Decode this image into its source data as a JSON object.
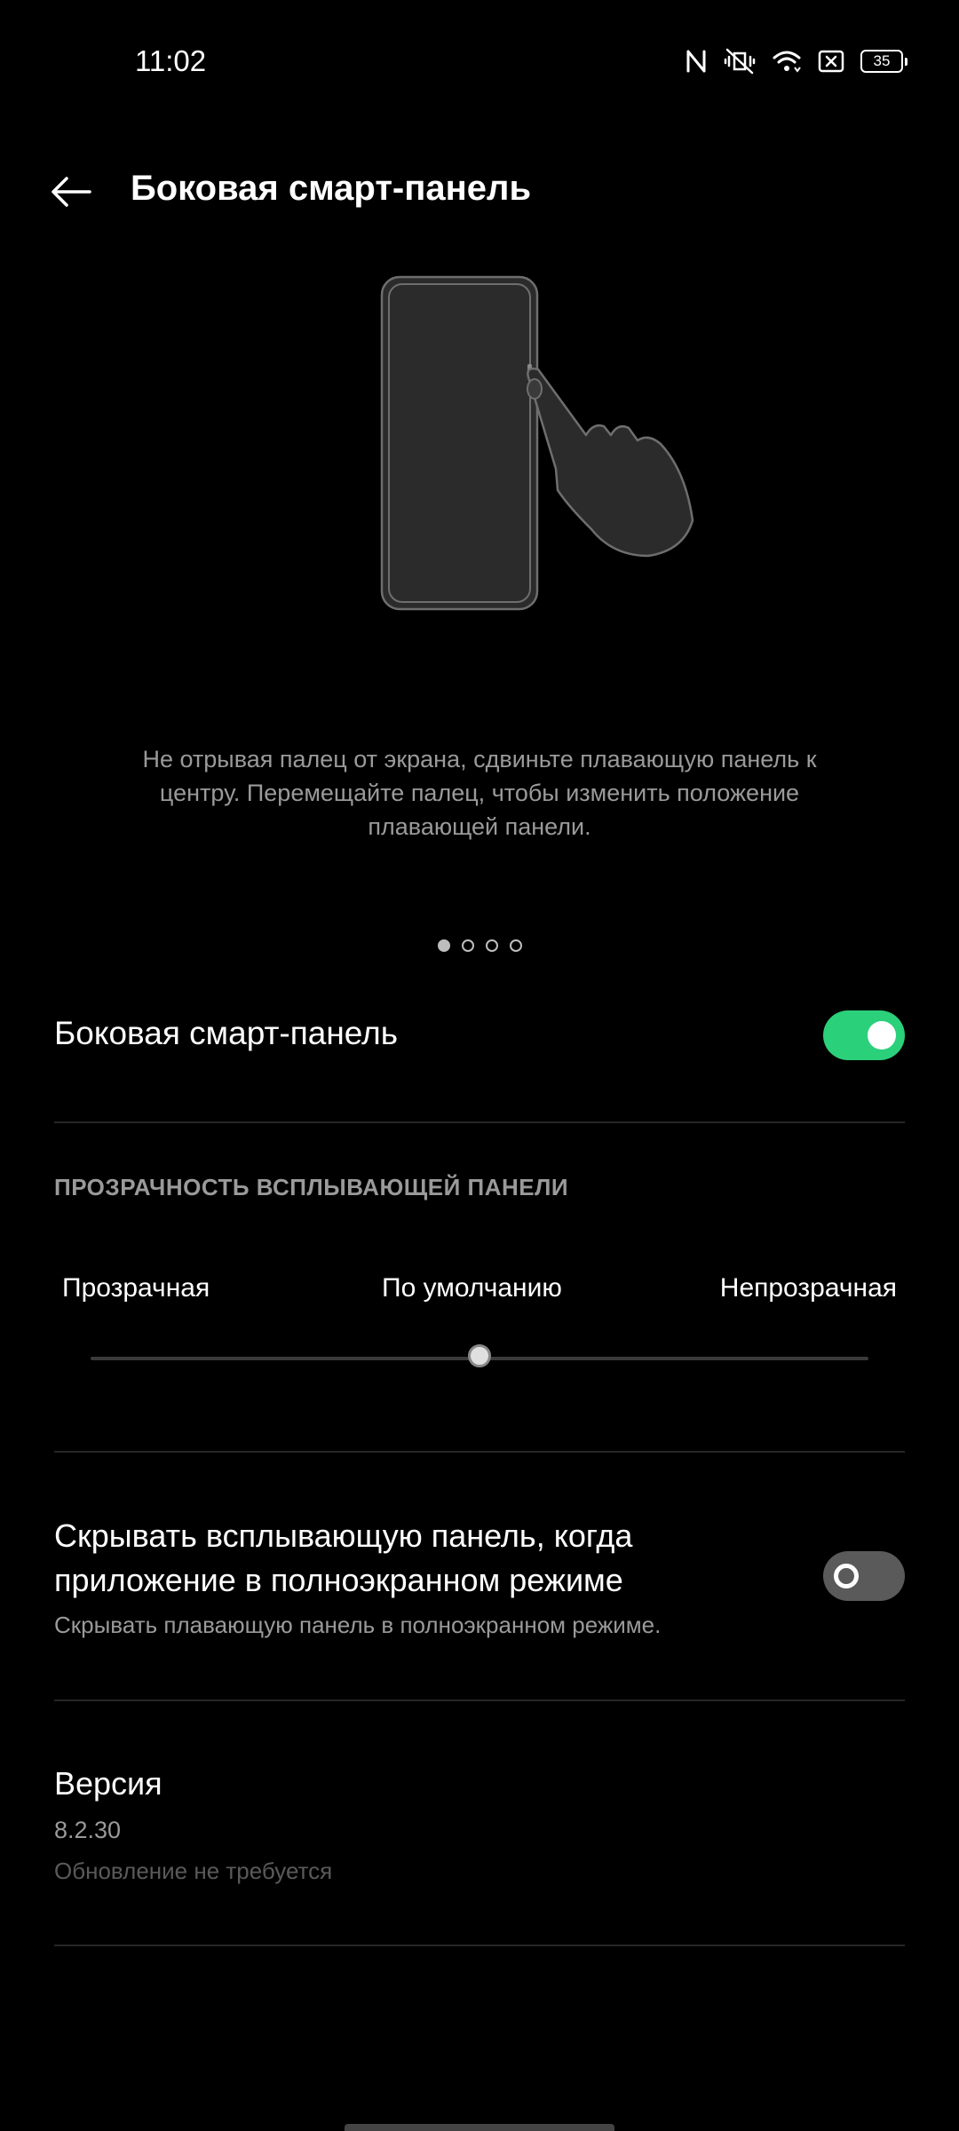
{
  "status_bar": {
    "time": "11:02",
    "battery_level": "35",
    "icons": [
      "nfc-icon",
      "vibrate-mute-icon",
      "wifi-icon",
      "screen-record-icon",
      "battery-icon"
    ]
  },
  "header": {
    "title": "Боковая смарт-панель",
    "back_icon": "back-arrow-icon"
  },
  "illustration": {
    "icon": "phone-swipe-illustration"
  },
  "hint": {
    "text": "Не отрывая палец от экрана, сдвиньте плавающую панель к центру. Перемещайте палец, чтобы изменить положение плавающей панели."
  },
  "pager": {
    "count": 4,
    "active_index": 0
  },
  "main_toggle": {
    "label": "Боковая смарт-панель",
    "state": true
  },
  "transparency": {
    "header": "ПРОЗРАЧНОСТЬ ВСПЛЫВАЮЩЕЙ ПАНЕЛИ",
    "labels": {
      "left": "Прозрачная",
      "middle": "По умолчанию",
      "right": "Непрозрачная"
    },
    "value": 0.5
  },
  "hide_fullscreen": {
    "title": "Скрывать всплывающую панель, когда приложение в полноэкранном режиме",
    "subtitle": "Скрывать плавающую панель в полноэкранном режиме.",
    "state": false
  },
  "version": {
    "title": "Версия",
    "number": "8.2.30",
    "status": "Обновление не требуется"
  },
  "colors": {
    "accent_green": "#2bd07a",
    "background": "#000000",
    "secondary_text": "#9a9a9a"
  }
}
